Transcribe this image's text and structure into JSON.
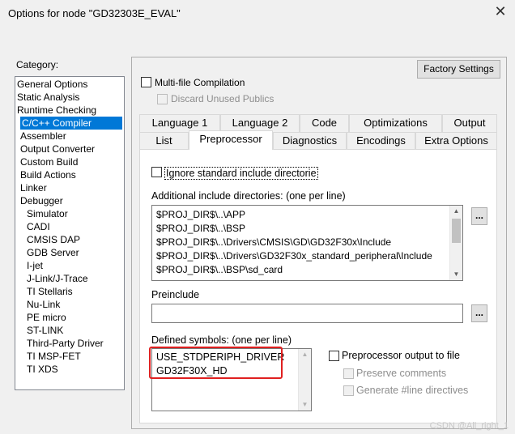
{
  "window": {
    "title": "Options for node \"GD32303E_EVAL\"",
    "close_glyph": "✕"
  },
  "category": {
    "label": "Category:",
    "items": [
      {
        "label": "General Options",
        "indent": false,
        "selected": false
      },
      {
        "label": "Static Analysis",
        "indent": false,
        "selected": false
      },
      {
        "label": "Runtime Checking",
        "indent": false,
        "selected": false
      },
      {
        "label": "C/C++ Compiler",
        "indent": true,
        "selected": true
      },
      {
        "label": "Assembler",
        "indent": true,
        "selected": false
      },
      {
        "label": "Output Converter",
        "indent": true,
        "selected": false
      },
      {
        "label": "Custom Build",
        "indent": true,
        "selected": false
      },
      {
        "label": "Build Actions",
        "indent": true,
        "selected": false
      },
      {
        "label": "Linker",
        "indent": true,
        "selected": false
      },
      {
        "label": "Debugger",
        "indent": true,
        "selected": false
      },
      {
        "label": "Simulator",
        "indent": true,
        "selected": false
      },
      {
        "label": "CADI",
        "indent": true,
        "selected": false
      },
      {
        "label": "CMSIS DAP",
        "indent": true,
        "selected": false
      },
      {
        "label": "GDB Server",
        "indent": true,
        "selected": false
      },
      {
        "label": "I-jet",
        "indent": true,
        "selected": false
      },
      {
        "label": "J-Link/J-Trace",
        "indent": true,
        "selected": false
      },
      {
        "label": "TI Stellaris",
        "indent": true,
        "selected": false
      },
      {
        "label": "Nu-Link",
        "indent": true,
        "selected": false
      },
      {
        "label": "PE micro",
        "indent": true,
        "selected": false
      },
      {
        "label": "ST-LINK",
        "indent": true,
        "selected": false
      },
      {
        "label": "Third-Party Driver",
        "indent": true,
        "selected": false
      },
      {
        "label": "TI MSP-FET",
        "indent": true,
        "selected": false
      },
      {
        "label": "TI XDS",
        "indent": true,
        "selected": false
      }
    ]
  },
  "factory_settings": "Factory Settings",
  "multi_file": {
    "label": "Multi-file Compilation",
    "checked": false
  },
  "discard_unused": {
    "label": "Discard Unused Publics",
    "checked": false
  },
  "tabs_row1": [
    "Language 1",
    "Language 2",
    "Code",
    "Optimizations",
    "Output"
  ],
  "tabs_row2": [
    "List",
    "Preprocessor",
    "Diagnostics",
    "Encodings",
    "Extra Options"
  ],
  "active_tab": "Preprocessor",
  "ignore_std": {
    "label": "Ignore standard include directorie",
    "checked": false
  },
  "include_dirs": {
    "label": "Additional include directories: (one per line)",
    "lines": [
      "$PROJ_DIR$\\..\\APP",
      "$PROJ_DIR$\\..\\BSP",
      "$PROJ_DIR$\\..\\Drivers\\CMSIS\\GD\\GD32F30x\\Include",
      "$PROJ_DIR$\\..\\Drivers\\GD32F30x_standard_peripheral\\Include",
      "$PROJ_DIR$\\..\\BSP\\sd_card"
    ],
    "button": "..."
  },
  "preinclude": {
    "label": "Preinclude",
    "value": "",
    "button": "..."
  },
  "defined_symbols": {
    "label": "Defined symbols: (one per line)",
    "lines": [
      "USE_STDPERIPH_DRIVER",
      "GD32F30X_HD"
    ]
  },
  "pp_output": {
    "label": "Preprocessor output to file",
    "checked": false
  },
  "preserve_comments": {
    "label": "Preserve comments",
    "checked": false
  },
  "generate_line": {
    "label": "Generate #line directives",
    "checked": false
  },
  "watermark": "CSDN @All_right_1",
  "colors": {
    "selection": "#0078d7",
    "highlight": "#e02020"
  }
}
